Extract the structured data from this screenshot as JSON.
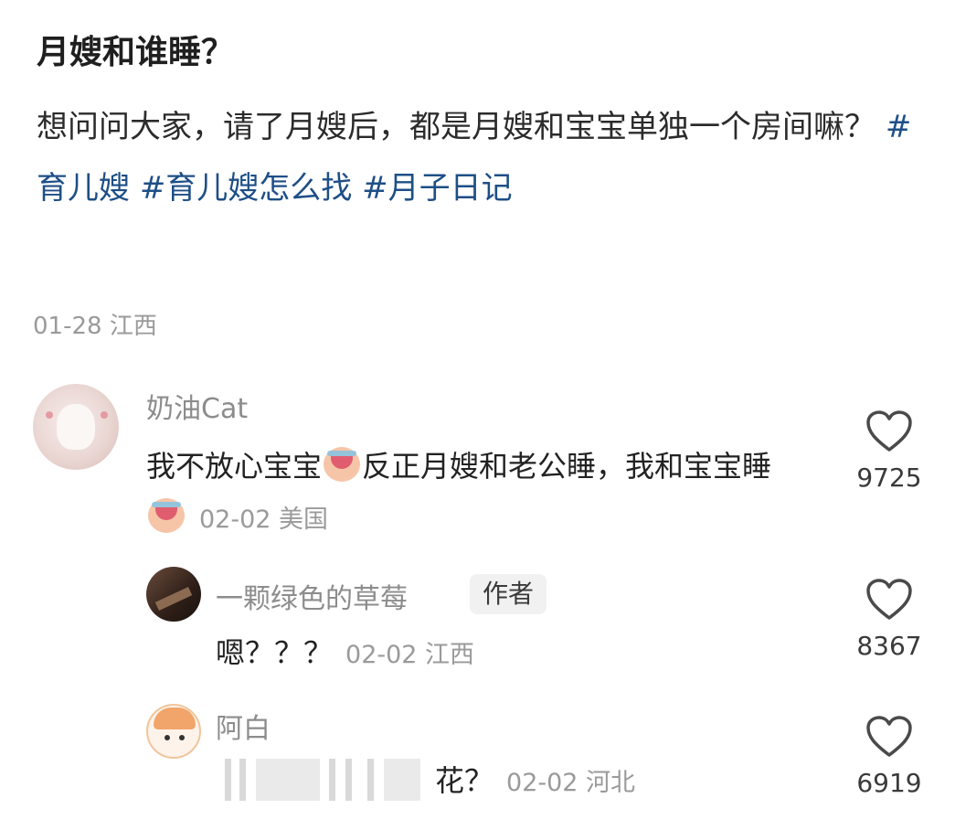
{
  "post": {
    "title": "月嫂和谁睡？",
    "body": "想问问大家，请了月嫂后，都是月嫂和宝宝单独一个房间嘛？",
    "tags": [
      "#育儿嫂",
      "#育儿嫂怎么找",
      "#月子日记"
    ],
    "meta": "01-28 江西"
  },
  "comments": [
    {
      "author": "奶油Cat",
      "text_part1": "我不放心宝宝",
      "text_part2": "反正月嫂和老公睡，我和宝宝睡",
      "meta": "02-02 美国",
      "likes": "9725",
      "avatar_icon": "cat-avatar"
    },
    {
      "author": "一颗绿色的草莓",
      "badge": "作者",
      "text": "嗯？？？",
      "meta": "02-02 江西",
      "likes": "8367",
      "avatar_icon": "author-avatar"
    },
    {
      "author": "阿白",
      "text": "花？",
      "meta": "02-02 河北",
      "likes": "6919",
      "avatar_icon": "bai-avatar"
    }
  ],
  "icons": {
    "like": "heart-outline-icon",
    "emoji": "crying-laughing-emoji-icon"
  }
}
